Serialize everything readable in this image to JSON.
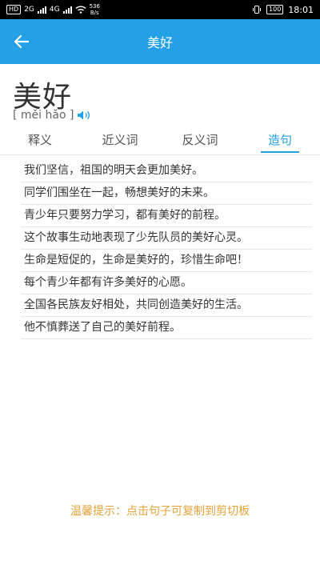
{
  "status_bar": {
    "left_chips": [
      "HD",
      "2G",
      "4G"
    ],
    "speed_value": "536",
    "speed_unit": "B/s",
    "battery": "100",
    "time": "18:01"
  },
  "app_bar": {
    "title": "美好"
  },
  "word": {
    "text": "美好",
    "pinyin": "[ měi hǎo ]"
  },
  "tabs": [
    {
      "label": "释义",
      "active": false
    },
    {
      "label": "近义词",
      "active": false
    },
    {
      "label": "反义词",
      "active": false
    },
    {
      "label": "造句",
      "active": true
    }
  ],
  "sentences": [
    "我们坚信，祖国的明天会更加美好。",
    "同学们围坐在一起，畅想美好的未来。",
    "青少年只要努力学习，都有美好的前程。",
    "这个故事生动地表现了少先队员的美好心灵。",
    "生命是短促的，生命是美好的，珍惜生命吧！",
    "每个青少年都有许多美好的心愿。",
    "全国各民族友好相处，共同创造美好的生活。",
    "他不慎葬送了自己的美好前程。"
  ],
  "hint": "温馨提示：点击句子可复制到剪切板",
  "colors": {
    "accent": "#24a0e6",
    "hint": "#e3a23a"
  }
}
